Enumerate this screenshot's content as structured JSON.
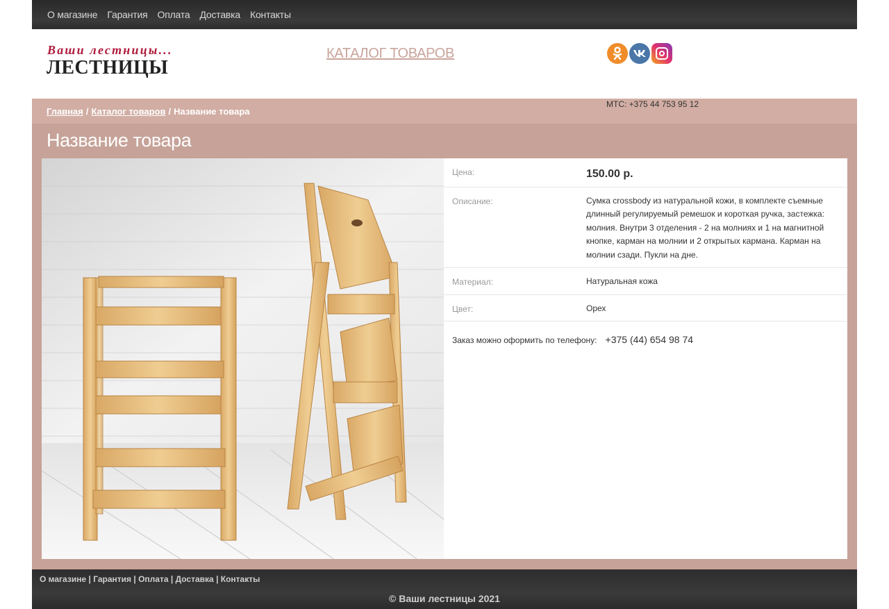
{
  "topnav": {
    "items": [
      {
        "label": "О магазине"
      },
      {
        "label": "Гарантия"
      },
      {
        "label": "Оплата"
      },
      {
        "label": "Доставка"
      },
      {
        "label": "Контакты"
      }
    ]
  },
  "header": {
    "logo_tagline": "Ваши лестницы...",
    "logo_title": "ЛЕСТНИЦЫ",
    "catalog_link": "КАТАЛОГ ТОВАРОВ",
    "socials": [
      {
        "icon": "odnoklassniki-icon",
        "glyph": "ок"
      },
      {
        "icon": "vk-icon",
        "glyph": "vk"
      },
      {
        "icon": "instagram-icon",
        "glyph": ""
      }
    ],
    "phone": "МТС: +375 44 753 95 12"
  },
  "breadcrumb": {
    "home": "Главная",
    "sep1": "/",
    "catalog": "Каталог товаров",
    "sep2": "/",
    "current": "Название товара"
  },
  "page_title": "Название товара",
  "product": {
    "price_label": "Цена:",
    "price_value": "150.00 р.",
    "description_label": "Описание:",
    "description_value": "Сумка crossbody из натуральной кожи, в комплекте съемные длинный регулируемый ремешок и короткая ручка, застежка: молния. Внутри 3 отделения - 2 на молниях и 1 на магнитной кнопке, карман на молнии и 2 открытых кармана. Карман на молнии сзади. Пукли на дне.",
    "material_label": "Материал:",
    "material_value": "Натуральная кожа",
    "color_label": "Цвет:",
    "color_value": "Орех",
    "order_text": "Заказ можно оформить по телефону:",
    "order_phone": "+375 (44) 654 98 74"
  },
  "footer": {
    "links": [
      {
        "label": "О магазине"
      },
      {
        "label": "Гарантия"
      },
      {
        "label": "Оплата"
      },
      {
        "label": "Доставка"
      },
      {
        "label": "Контакты"
      }
    ],
    "separator": "|",
    "copyright": "© Ваши лестницы 2021"
  },
  "colors": {
    "accent": "#c6a298",
    "breadcrumb_bg": "#d1ada3",
    "logo_red": "#b01a3c",
    "nav_bg": "#333333"
  }
}
